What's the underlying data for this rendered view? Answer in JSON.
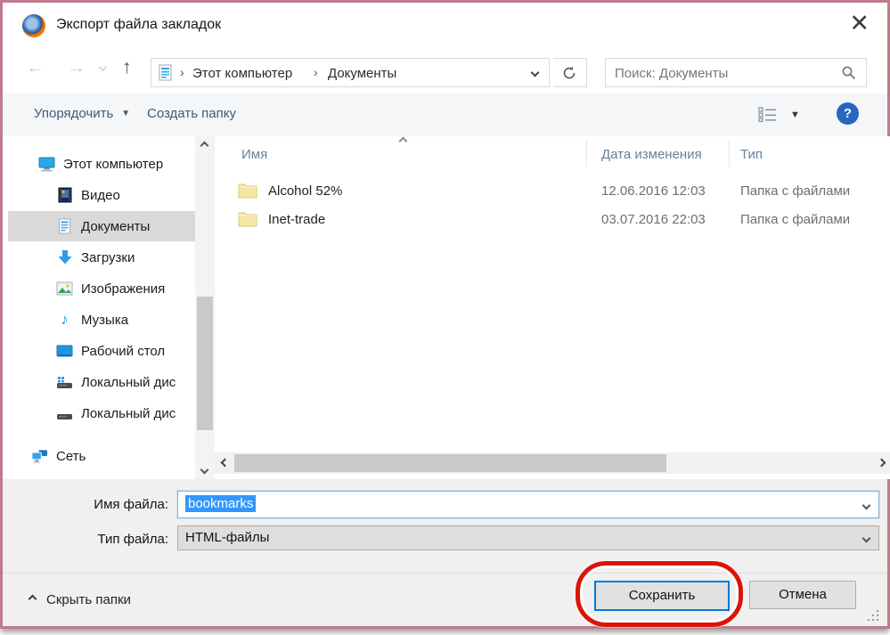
{
  "window": {
    "title": "Экспорт файла закладок",
    "close_glyph": "✕"
  },
  "navbar": {
    "breadcrumb_root": "Этот компьютер",
    "breadcrumb_current": "Документы",
    "search_text": "Поиск: Документы"
  },
  "toolbar": {
    "organize": "Упорядочить",
    "new_folder": "Создать папку",
    "help_glyph": "?"
  },
  "sidebar": {
    "items": [
      {
        "label": "Этот компьютер",
        "icon": "computer-icon"
      },
      {
        "label": "Видео",
        "icon": "video-icon"
      },
      {
        "label": "Документы",
        "icon": "documents-icon",
        "selected": true
      },
      {
        "label": "Загрузки",
        "icon": "downloads-icon"
      },
      {
        "label": "Изображения",
        "icon": "pictures-icon"
      },
      {
        "label": "Музыка",
        "icon": "music-icon"
      },
      {
        "label": "Рабочий стол",
        "icon": "desktop-icon"
      },
      {
        "label": "Локальный дис",
        "icon": "local-disk-system-icon"
      },
      {
        "label": "Локальный дис",
        "icon": "local-disk-icon"
      },
      {
        "label": "Сеть",
        "icon": "network-icon"
      }
    ]
  },
  "file_list": {
    "columns": {
      "name": "Имя",
      "date": "Дата изменения",
      "type": "Тип"
    },
    "rows": [
      {
        "name": "Alcohol 52%",
        "date": "12.06.2016 12:03",
        "type": "Папка с файлами"
      },
      {
        "name": "Inet-trade",
        "date": "03.07.2016 22:03",
        "type": "Папка с файлами"
      }
    ]
  },
  "form": {
    "name_label": "Имя файла:",
    "name_value": "bookmarks",
    "type_label": "Тип файла:",
    "type_value": "HTML-файлы"
  },
  "footer": {
    "hide_folders": "Скрыть папки",
    "save": "Сохранить",
    "cancel": "Отмена"
  },
  "colors": {
    "window_border": "#bd7b8b",
    "selection_blue": "#3297fd",
    "save_border_blue": "#0078d7",
    "annotation_red": "#dc1408",
    "help_blue": "#2766bf",
    "toolbar_link": "#3e5a77"
  }
}
